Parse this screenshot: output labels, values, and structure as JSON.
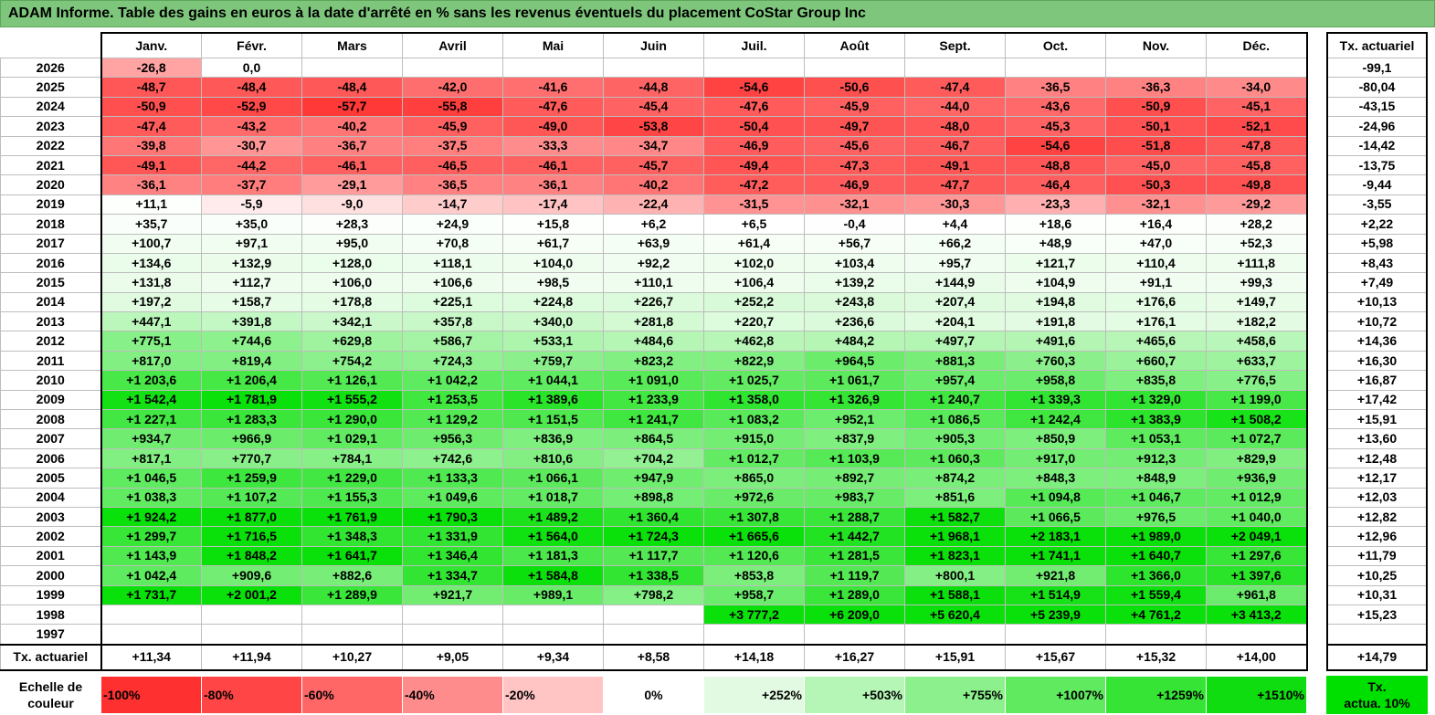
{
  "title": "ADAM Informe. Table des gains en euros à la date d'arrêté en % sans les revenus éventuels du placement CoStar Group Inc",
  "months": [
    "Janv.",
    "Févr.",
    "Mars",
    "Avril",
    "Mai",
    "Juin",
    "Juil.",
    "Août",
    "Sept.",
    "Oct.",
    "Nov.",
    "Déc."
  ],
  "side_header": "Tx. actuariel",
  "rows": [
    {
      "year": "2026",
      "values": [
        "-26,8",
        "0,0",
        "",
        "",
        "",
        "",
        "",
        "",
        "",
        "",
        "",
        ""
      ],
      "rate": "-99,1"
    },
    {
      "year": "2025",
      "values": [
        "-48,7",
        "-48,4",
        "-48,4",
        "-42,0",
        "-41,6",
        "-44,8",
        "-54,6",
        "-50,6",
        "-47,4",
        "-36,5",
        "-36,3",
        "-34,0"
      ],
      "rate": "-80,04"
    },
    {
      "year": "2024",
      "values": [
        "-50,9",
        "-52,9",
        "-57,7",
        "-55,8",
        "-47,6",
        "-45,4",
        "-47,6",
        "-45,9",
        "-44,0",
        "-43,6",
        "-50,9",
        "-45,1"
      ],
      "rate": "-43,15"
    },
    {
      "year": "2023",
      "values": [
        "-47,4",
        "-43,2",
        "-40,2",
        "-45,9",
        "-49,0",
        "-53,8",
        "-50,4",
        "-49,7",
        "-48,0",
        "-45,3",
        "-50,1",
        "-52,1"
      ],
      "rate": "-24,96"
    },
    {
      "year": "2022",
      "values": [
        "-39,8",
        "-30,7",
        "-36,7",
        "-37,5",
        "-33,3",
        "-34,7",
        "-46,9",
        "-45,6",
        "-46,7",
        "-54,6",
        "-51,8",
        "-47,8"
      ],
      "rate": "-14,42"
    },
    {
      "year": "2021",
      "values": [
        "-49,1",
        "-44,2",
        "-46,1",
        "-46,5",
        "-46,1",
        "-45,7",
        "-49,4",
        "-47,3",
        "-49,1",
        "-48,8",
        "-45,0",
        "-45,8"
      ],
      "rate": "-13,75"
    },
    {
      "year": "2020",
      "values": [
        "-36,1",
        "-37,7",
        "-29,1",
        "-36,5",
        "-36,1",
        "-40,2",
        "-47,2",
        "-46,9",
        "-47,7",
        "-46,4",
        "-50,3",
        "-49,8"
      ],
      "rate": "-9,44"
    },
    {
      "year": "2019",
      "values": [
        "+11,1",
        "-5,9",
        "-9,0",
        "-14,7",
        "-17,4",
        "-22,4",
        "-31,5",
        "-32,1",
        "-30,3",
        "-23,3",
        "-32,1",
        "-29,2"
      ],
      "rate": "-3,55"
    },
    {
      "year": "2018",
      "values": [
        "+35,7",
        "+35,0",
        "+28,3",
        "+24,9",
        "+15,8",
        "+6,2",
        "+6,5",
        "-0,4",
        "+4,4",
        "+18,6",
        "+16,4",
        "+28,2"
      ],
      "rate": "+2,22"
    },
    {
      "year": "2017",
      "values": [
        "+100,7",
        "+97,1",
        "+95,0",
        "+70,8",
        "+61,7",
        "+63,9",
        "+61,4",
        "+56,7",
        "+66,2",
        "+48,9",
        "+47,0",
        "+52,3"
      ],
      "rate": "+5,98"
    },
    {
      "year": "2016",
      "values": [
        "+134,6",
        "+132,9",
        "+128,0",
        "+118,1",
        "+104,0",
        "+92,2",
        "+102,0",
        "+103,4",
        "+95,7",
        "+121,7",
        "+110,4",
        "+111,8"
      ],
      "rate": "+8,43"
    },
    {
      "year": "2015",
      "values": [
        "+131,8",
        "+112,7",
        "+106,0",
        "+106,6",
        "+98,5",
        "+110,1",
        "+106,4",
        "+139,2",
        "+144,9",
        "+104,9",
        "+91,1",
        "+99,3"
      ],
      "rate": "+7,49"
    },
    {
      "year": "2014",
      "values": [
        "+197,2",
        "+158,7",
        "+178,8",
        "+225,1",
        "+224,8",
        "+226,7",
        "+252,2",
        "+243,8",
        "+207,4",
        "+194,8",
        "+176,6",
        "+149,7"
      ],
      "rate": "+10,13"
    },
    {
      "year": "2013",
      "values": [
        "+447,1",
        "+391,8",
        "+342,1",
        "+357,8",
        "+340,0",
        "+281,8",
        "+220,7",
        "+236,6",
        "+204,1",
        "+191,8",
        "+176,1",
        "+182,2"
      ],
      "rate": "+10,72"
    },
    {
      "year": "2012",
      "values": [
        "+775,1",
        "+744,6",
        "+629,8",
        "+586,7",
        "+533,1",
        "+484,6",
        "+462,8",
        "+484,2",
        "+497,7",
        "+491,6",
        "+465,6",
        "+458,6"
      ],
      "rate": "+14,36"
    },
    {
      "year": "2011",
      "values": [
        "+817,0",
        "+819,4",
        "+754,2",
        "+724,3",
        "+759,7",
        "+823,2",
        "+822,9",
        "+964,5",
        "+881,3",
        "+760,3",
        "+660,7",
        "+633,7"
      ],
      "rate": "+16,30"
    },
    {
      "year": "2010",
      "values": [
        "+1 203,6",
        "+1 206,4",
        "+1 126,1",
        "+1 042,2",
        "+1 044,1",
        "+1 091,0",
        "+1 025,7",
        "+1 061,7",
        "+957,4",
        "+958,8",
        "+835,8",
        "+776,5"
      ],
      "rate": "+16,87"
    },
    {
      "year": "2009",
      "values": [
        "+1 542,4",
        "+1 781,9",
        "+1 555,2",
        "+1 253,5",
        "+1 389,6",
        "+1 233,9",
        "+1 358,0",
        "+1 326,9",
        "+1 240,7",
        "+1 339,3",
        "+1 329,0",
        "+1 199,0"
      ],
      "rate": "+17,42"
    },
    {
      "year": "2008",
      "values": [
        "+1 227,1",
        "+1 283,3",
        "+1 290,0",
        "+1 129,2",
        "+1 151,5",
        "+1 241,7",
        "+1 083,2",
        "+952,1",
        "+1 086,5",
        "+1 242,4",
        "+1 383,9",
        "+1 508,2"
      ],
      "rate": "+15,91"
    },
    {
      "year": "2007",
      "values": [
        "+934,7",
        "+966,9",
        "+1 029,1",
        "+956,3",
        "+836,9",
        "+864,5",
        "+915,0",
        "+837,9",
        "+905,3",
        "+850,9",
        "+1 053,1",
        "+1 072,7"
      ],
      "rate": "+13,60"
    },
    {
      "year": "2006",
      "values": [
        "+817,1",
        "+770,7",
        "+784,1",
        "+742,6",
        "+810,6",
        "+704,2",
        "+1 012,7",
        "+1 103,9",
        "+1 060,3",
        "+917,0",
        "+912,3",
        "+829,9"
      ],
      "rate": "+12,48"
    },
    {
      "year": "2005",
      "values": [
        "+1 046,5",
        "+1 259,9",
        "+1 229,0",
        "+1 133,3",
        "+1 066,1",
        "+947,9",
        "+865,0",
        "+892,7",
        "+874,2",
        "+848,3",
        "+848,9",
        "+936,9"
      ],
      "rate": "+12,17"
    },
    {
      "year": "2004",
      "values": [
        "+1 038,3",
        "+1 107,2",
        "+1 155,3",
        "+1 049,6",
        "+1 018,7",
        "+898,8",
        "+972,6",
        "+983,7",
        "+851,6",
        "+1 094,8",
        "+1 046,7",
        "+1 012,9"
      ],
      "rate": "+12,03"
    },
    {
      "year": "2003",
      "values": [
        "+1 924,2",
        "+1 877,0",
        "+1 761,9",
        "+1 790,3",
        "+1 489,2",
        "+1 360,4",
        "+1 307,8",
        "+1 288,7",
        "+1 582,7",
        "+1 066,5",
        "+976,5",
        "+1 040,0"
      ],
      "rate": "+12,82"
    },
    {
      "year": "2002",
      "values": [
        "+1 299,7",
        "+1 716,5",
        "+1 348,3",
        "+1 331,9",
        "+1 564,0",
        "+1 724,3",
        "+1 665,6",
        "+1 442,7",
        "+1 968,1",
        "+2 183,1",
        "+1 989,0",
        "+2 049,1"
      ],
      "rate": "+12,96"
    },
    {
      "year": "2001",
      "values": [
        "+1 143,9",
        "+1 848,2",
        "+1 641,7",
        "+1 346,4",
        "+1 181,3",
        "+1 117,7",
        "+1 120,6",
        "+1 281,5",
        "+1 823,1",
        "+1 741,1",
        "+1 640,7",
        "+1 297,6"
      ],
      "rate": "+11,79"
    },
    {
      "year": "2000",
      "values": [
        "+1 042,4",
        "+909,6",
        "+882,6",
        "+1 334,7",
        "+1 584,8",
        "+1 338,5",
        "+853,8",
        "+1 119,7",
        "+800,1",
        "+921,8",
        "+1 366,0",
        "+1 397,6"
      ],
      "rate": "+10,25"
    },
    {
      "year": "1999",
      "values": [
        "+1 731,7",
        "+2 001,2",
        "+1 289,9",
        "+921,7",
        "+989,1",
        "+798,2",
        "+958,7",
        "+1 289,0",
        "+1 588,1",
        "+1 514,9",
        "+1 559,4",
        "+961,8"
      ],
      "rate": "+10,31"
    },
    {
      "year": "1998",
      "values": [
        "",
        "",
        "",
        "",
        "",
        "",
        "+3 777,2",
        "+6 209,0",
        "+5 620,4",
        "+5 239,9",
        "+4 761,2",
        "+3 413,2"
      ],
      "rate": "+15,23"
    },
    {
      "year": "1997",
      "values": [
        "",
        "",
        "",
        "",
        "",
        "",
        "",
        "",
        "",
        "",
        "",
        ""
      ],
      "rate": ""
    }
  ],
  "footer": {
    "label": "Tx. actuariel",
    "values": [
      "+11,34",
      "+11,94",
      "+10,27",
      "+9,05",
      "+9,34",
      "+8,58",
      "+14,18",
      "+16,27",
      "+15,91",
      "+15,67",
      "+15,32",
      "+14,00"
    ],
    "overall": "+14,79"
  },
  "scale": {
    "label_line1": "Echelle de",
    "label_line2": "couleur",
    "steps": [
      {
        "label": "-100%",
        "color": "#ff3030"
      },
      {
        "label": "-80%",
        "color": "#ff4545"
      },
      {
        "label": "-60%",
        "color": "#ff6666"
      },
      {
        "label": "-40%",
        "color": "#ff8c8c"
      },
      {
        "label": "-20%",
        "color": "#ffc4c4"
      },
      {
        "label": "0%",
        "color": "#ffffff"
      },
      {
        "label": "+252%",
        "color": "#e2fae2"
      },
      {
        "label": "+503%",
        "color": "#b5f5b5"
      },
      {
        "label": "+755%",
        "color": "#8cf08c"
      },
      {
        "label": "+1007%",
        "color": "#60ea60"
      },
      {
        "label": "+1259%",
        "color": "#35e435"
      },
      {
        "label": "+1510%",
        "color": "#0fdd0f"
      }
    ],
    "side_line1": "Tx.",
    "side_line2": "actua. 10%"
  }
}
